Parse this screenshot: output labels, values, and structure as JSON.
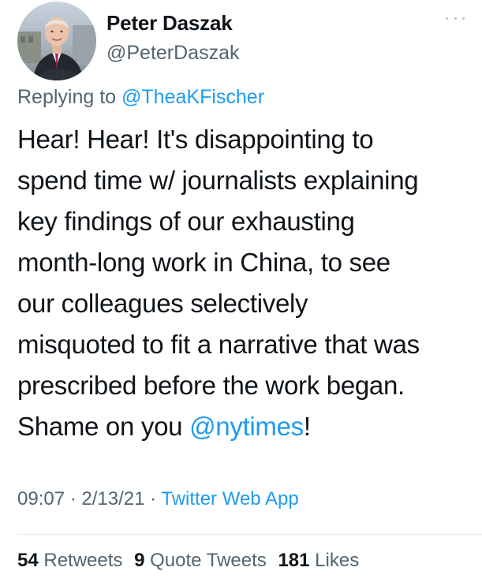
{
  "author": {
    "name": "Peter Daszak",
    "handle": "@PeterDaszak"
  },
  "more_icon": "more-horizontal-icon",
  "reply": {
    "prefix": "Replying to",
    "to": "@TheaKFischer"
  },
  "tweet_lines": [
    "Hear! Hear! It's disappointing to",
    "spend time w/ journalists explaining",
    "key findings of our exhausting",
    "month-long work in China, to see",
    "our colleagues selectively",
    "misquoted to fit a narrative that was",
    "prescribed before the work began."
  ],
  "last_line": {
    "before": "Shame on you ",
    "mention": "@nytimes",
    "after": "!"
  },
  "meta": {
    "time": "09:07",
    "sep1": " · ",
    "date": "2/13/21",
    "sep2": " · ",
    "source": "Twitter Web App"
  },
  "stats": {
    "retweets_count": "54",
    "retweets_label": "Retweets",
    "quotes_count": "9",
    "quotes_label": "Quote Tweets",
    "likes_count": "181",
    "likes_label": "Likes"
  },
  "colors": {
    "link": "#1d9bf0",
    "text": "#0f1419",
    "secondary": "#536471"
  }
}
